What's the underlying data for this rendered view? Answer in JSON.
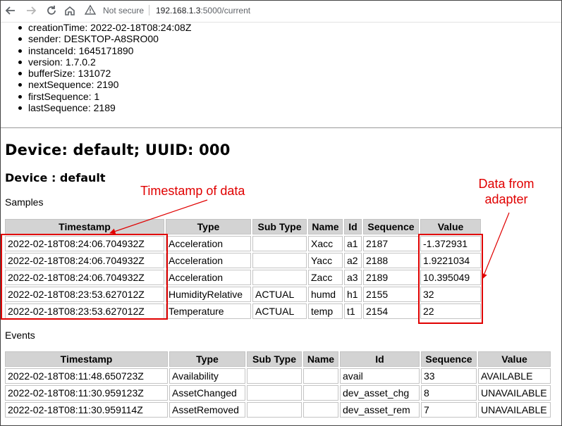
{
  "browser": {
    "back_icon": "arrow-left-icon",
    "forward_icon": "arrow-right-icon",
    "reload_icon": "reload-icon",
    "home_icon": "home-icon",
    "security_label": "Not secure",
    "url_host": "192.168.1.3",
    "url_rest": ":5000/current"
  },
  "header": [
    "creationTime: 2022-02-18T08:24:08Z",
    "sender: DESKTOP-A8SRO00",
    "instanceId: 1645171890",
    "version: 1.7.0.2",
    "bufferSize: 131072",
    "nextSequence: 2190",
    "firstSequence: 1",
    "lastSequence: 2189"
  ],
  "device_heading": "Device: default; UUID: 000",
  "component_heading": "Device : default",
  "samples": {
    "label": "Samples",
    "columns": [
      "Timestamp",
      "Type",
      "Sub Type",
      "Name",
      "Id",
      "Sequence",
      "Value"
    ],
    "rows": [
      [
        "2022-02-18T08:24:06.704932Z",
        "Acceleration",
        "",
        "Xacc",
        "a1",
        "2187",
        "-1.372931"
      ],
      [
        "2022-02-18T08:24:06.704932Z",
        "Acceleration",
        "",
        "Yacc",
        "a2",
        "2188",
        "1.9221034"
      ],
      [
        "2022-02-18T08:24:06.704932Z",
        "Acceleration",
        "",
        "Zacc",
        "a3",
        "2189",
        "10.395049"
      ],
      [
        "2022-02-18T08:23:53.627012Z",
        "HumidityRelative",
        "ACTUAL",
        "humd",
        "h1",
        "2155",
        "32"
      ],
      [
        "2022-02-18T08:23:53.627012Z",
        "Temperature",
        "ACTUAL",
        "temp",
        "t1",
        "2154",
        "22"
      ]
    ]
  },
  "events": {
    "label": "Events",
    "columns": [
      "Timestamp",
      "Type",
      "Sub Type",
      "Name",
      "Id",
      "Sequence",
      "Value"
    ],
    "rows": [
      [
        "2022-02-18T08:11:48.650723Z",
        "Availability",
        "",
        "",
        "avail",
        "33",
        "AVAILABLE"
      ],
      [
        "2022-02-18T08:11:30.959123Z",
        "AssetChanged",
        "",
        "",
        "dev_asset_chg",
        "8",
        "UNAVAILABLE"
      ],
      [
        "2022-02-18T08:11:30.959114Z",
        "AssetRemoved",
        "",
        "",
        "dev_asset_rem",
        "7",
        "UNAVAILABLE"
      ]
    ]
  },
  "annotations": {
    "timestamp_note": "Timestamp of data",
    "adapter_note_line1": "Data from",
    "adapter_note_line2": "adapter",
    "color": "#e00000"
  }
}
